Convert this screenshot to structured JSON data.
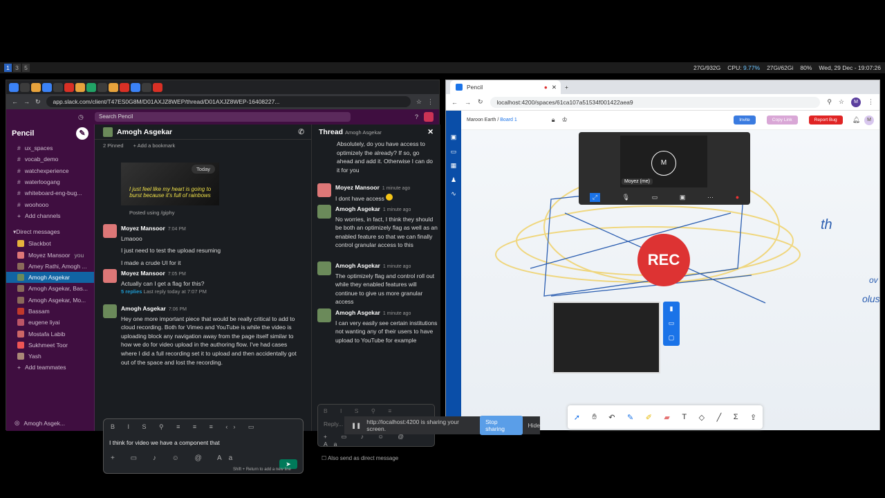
{
  "topbar": {
    "workspaces": [
      "1",
      "3",
      "5"
    ],
    "disk": "27G/932G",
    "cpu_label": "CPU:",
    "cpu": "9.77%",
    "mem": "27Gi/62Gi",
    "volume": "80%",
    "datetime": "Wed, 29 Dec - 19:07:26"
  },
  "slack": {
    "url": "app.slack.com/client/T47ES0G8M/D01AXJZ8WEP/thread/D01AXJZ8WEP-16408227...",
    "search_placeholder": "Search Pencil",
    "workspace": "Pencil",
    "channels": [
      "ux_spaces",
      "vocab_demo",
      "watchexperience",
      "waterloogang",
      "whiteboard-eng-bug...",
      "woohooo"
    ],
    "add_channels": "Add channels",
    "dm_header": "Direct messages",
    "dms": [
      "Slackbot",
      "Moyez Mansoor",
      "Amey Rathi, Amogh ...",
      "Amogh Asgekar",
      "Amogh Asgekar, Bas...",
      "Amogh Asgekar, Mo...",
      "Bassam",
      "eugene liyai",
      "Mostafa Labib",
      "Sukhmeet Toor",
      "Yash"
    ],
    "you_label": "you",
    "add_teammates": "Add teammates",
    "footer_user": "Amogh Asgek...",
    "chat_title": "Amogh Asgekar",
    "pinned": "2 Pinned",
    "bookmark": "+ Add a bookmark",
    "gif_caption": "I just feel like my heart is going to burst because it's full of rainbows",
    "today": "Today",
    "giphy": "Posted using /giphy",
    "messages": [
      {
        "name": "Moyez Mansoor",
        "time": "7:04 PM",
        "lines": [
          "Lmaooo",
          "I just need to test the upload resuming",
          "I made a crude UI for it"
        ]
      },
      {
        "name": "Moyez Mansoor",
        "time": "7:05 PM",
        "lines": [
          "Actually can I get a flag for this?"
        ],
        "replies": "5 replies",
        "last_reply": "Last reply today at 7:07 PM"
      },
      {
        "name": "Amogh Asgekar",
        "time": "7:06 PM",
        "lines": [
          "Hey one more important piece that would be really critical to add to cloud recording. Both for Vimeo and YouTube is while the video is uploading block any navigation away from the page itself similar to how we do for video upload in the authoring flow. I've had cases where I did a full recording set it to upload and then accidentally got out of the space and lost the recording."
        ]
      }
    ],
    "composer_text": "I think for video we have a component that",
    "composer_hint": "Shift + Return to add a new line",
    "thread_title": "Thread",
    "thread_sub": "Amogh Asgekar",
    "thread_top": "Absolutely, do you have access to optimizely the already? If so, go ahead and add it. Otherwise I can do it for you",
    "thread": [
      {
        "name": "Moyez Mansoor",
        "time": "1 minute ago",
        "text": "I dont have access"
      },
      {
        "name": "Amogh Asgekar",
        "time": "1 minute ago",
        "text": "No worries, in fact, I think they should be both an optimizely flag as well as an enabled feature so that we can finally control granular access to this"
      },
      {
        "name": "Amogh Asgekar",
        "time": "1 minute ago",
        "text": "The optimizely flag and control roll out while they enabled features will continue to give us more granular access"
      },
      {
        "name": "Amogh Asgekar",
        "time": "1 minute ago",
        "text": "I can very easily see certain institutions not wanting any of their users to have upload to YouTube for example"
      }
    ],
    "reply_placeholder": "Reply...",
    "also_send": "Also send as direct message"
  },
  "pencil": {
    "tab": "Pencil",
    "url": "localhost:4200/spaces/61ca107a51534f001422aea9",
    "breadcrumb_1": "Maroon Earth",
    "breadcrumb_2": "Board 1",
    "invite": "Invite",
    "copy_link": "Copy Link",
    "report_bug": "Report Bug",
    "avatar": "M",
    "video_user": "Moyez (me)",
    "rec": "REC",
    "handwriting": [
      "th",
      "olus",
      "ov"
    ]
  },
  "share": {
    "text": "http://localhost:4200 is sharing your screen.",
    "stop": "Stop sharing",
    "hide": "Hide"
  }
}
